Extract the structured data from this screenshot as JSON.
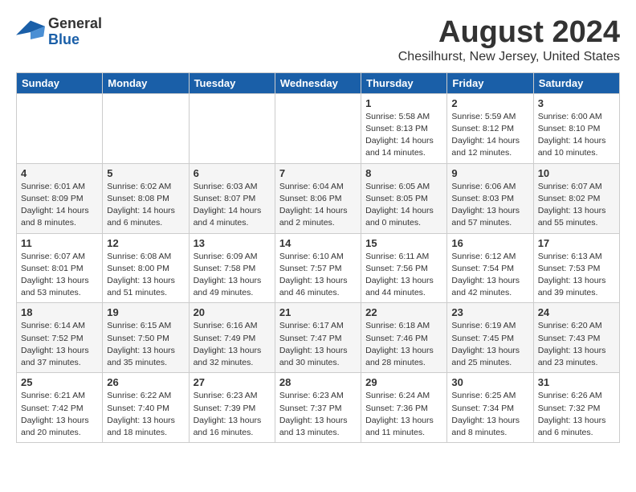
{
  "logo": {
    "line1": "General",
    "line2": "Blue"
  },
  "title": "August 2024",
  "subtitle": "Chesilhurst, New Jersey, United States",
  "weekdays": [
    "Sunday",
    "Monday",
    "Tuesday",
    "Wednesday",
    "Thursday",
    "Friday",
    "Saturday"
  ],
  "weeks": [
    [
      {
        "day": "",
        "info": ""
      },
      {
        "day": "",
        "info": ""
      },
      {
        "day": "",
        "info": ""
      },
      {
        "day": "",
        "info": ""
      },
      {
        "day": "1",
        "info": "Sunrise: 5:58 AM\nSunset: 8:13 PM\nDaylight: 14 hours\nand 14 minutes."
      },
      {
        "day": "2",
        "info": "Sunrise: 5:59 AM\nSunset: 8:12 PM\nDaylight: 14 hours\nand 12 minutes."
      },
      {
        "day": "3",
        "info": "Sunrise: 6:00 AM\nSunset: 8:10 PM\nDaylight: 14 hours\nand 10 minutes."
      }
    ],
    [
      {
        "day": "4",
        "info": "Sunrise: 6:01 AM\nSunset: 8:09 PM\nDaylight: 14 hours\nand 8 minutes."
      },
      {
        "day": "5",
        "info": "Sunrise: 6:02 AM\nSunset: 8:08 PM\nDaylight: 14 hours\nand 6 minutes."
      },
      {
        "day": "6",
        "info": "Sunrise: 6:03 AM\nSunset: 8:07 PM\nDaylight: 14 hours\nand 4 minutes."
      },
      {
        "day": "7",
        "info": "Sunrise: 6:04 AM\nSunset: 8:06 PM\nDaylight: 14 hours\nand 2 minutes."
      },
      {
        "day": "8",
        "info": "Sunrise: 6:05 AM\nSunset: 8:05 PM\nDaylight: 14 hours\nand 0 minutes."
      },
      {
        "day": "9",
        "info": "Sunrise: 6:06 AM\nSunset: 8:03 PM\nDaylight: 13 hours\nand 57 minutes."
      },
      {
        "day": "10",
        "info": "Sunrise: 6:07 AM\nSunset: 8:02 PM\nDaylight: 13 hours\nand 55 minutes."
      }
    ],
    [
      {
        "day": "11",
        "info": "Sunrise: 6:07 AM\nSunset: 8:01 PM\nDaylight: 13 hours\nand 53 minutes."
      },
      {
        "day": "12",
        "info": "Sunrise: 6:08 AM\nSunset: 8:00 PM\nDaylight: 13 hours\nand 51 minutes."
      },
      {
        "day": "13",
        "info": "Sunrise: 6:09 AM\nSunset: 7:58 PM\nDaylight: 13 hours\nand 49 minutes."
      },
      {
        "day": "14",
        "info": "Sunrise: 6:10 AM\nSunset: 7:57 PM\nDaylight: 13 hours\nand 46 minutes."
      },
      {
        "day": "15",
        "info": "Sunrise: 6:11 AM\nSunset: 7:56 PM\nDaylight: 13 hours\nand 44 minutes."
      },
      {
        "day": "16",
        "info": "Sunrise: 6:12 AM\nSunset: 7:54 PM\nDaylight: 13 hours\nand 42 minutes."
      },
      {
        "day": "17",
        "info": "Sunrise: 6:13 AM\nSunset: 7:53 PM\nDaylight: 13 hours\nand 39 minutes."
      }
    ],
    [
      {
        "day": "18",
        "info": "Sunrise: 6:14 AM\nSunset: 7:52 PM\nDaylight: 13 hours\nand 37 minutes."
      },
      {
        "day": "19",
        "info": "Sunrise: 6:15 AM\nSunset: 7:50 PM\nDaylight: 13 hours\nand 35 minutes."
      },
      {
        "day": "20",
        "info": "Sunrise: 6:16 AM\nSunset: 7:49 PM\nDaylight: 13 hours\nand 32 minutes."
      },
      {
        "day": "21",
        "info": "Sunrise: 6:17 AM\nSunset: 7:47 PM\nDaylight: 13 hours\nand 30 minutes."
      },
      {
        "day": "22",
        "info": "Sunrise: 6:18 AM\nSunset: 7:46 PM\nDaylight: 13 hours\nand 28 minutes."
      },
      {
        "day": "23",
        "info": "Sunrise: 6:19 AM\nSunset: 7:45 PM\nDaylight: 13 hours\nand 25 minutes."
      },
      {
        "day": "24",
        "info": "Sunrise: 6:20 AM\nSunset: 7:43 PM\nDaylight: 13 hours\nand 23 minutes."
      }
    ],
    [
      {
        "day": "25",
        "info": "Sunrise: 6:21 AM\nSunset: 7:42 PM\nDaylight: 13 hours\nand 20 minutes."
      },
      {
        "day": "26",
        "info": "Sunrise: 6:22 AM\nSunset: 7:40 PM\nDaylight: 13 hours\nand 18 minutes."
      },
      {
        "day": "27",
        "info": "Sunrise: 6:23 AM\nSunset: 7:39 PM\nDaylight: 13 hours\nand 16 minutes."
      },
      {
        "day": "28",
        "info": "Sunrise: 6:23 AM\nSunset: 7:37 PM\nDaylight: 13 hours\nand 13 minutes."
      },
      {
        "day": "29",
        "info": "Sunrise: 6:24 AM\nSunset: 7:36 PM\nDaylight: 13 hours\nand 11 minutes."
      },
      {
        "day": "30",
        "info": "Sunrise: 6:25 AM\nSunset: 7:34 PM\nDaylight: 13 hours\nand 8 minutes."
      },
      {
        "day": "31",
        "info": "Sunrise: 6:26 AM\nSunset: 7:32 PM\nDaylight: 13 hours\nand 6 minutes."
      }
    ]
  ]
}
